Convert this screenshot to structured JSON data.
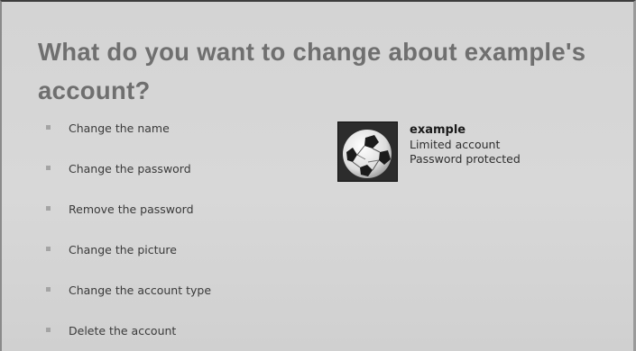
{
  "heading": "What do you want to change about example's account?",
  "tasks": [
    {
      "label": "Change the name"
    },
    {
      "label": "Change the password"
    },
    {
      "label": "Remove the password"
    },
    {
      "label": "Change the picture"
    },
    {
      "label": "Change the account type"
    },
    {
      "label": "Delete the account"
    }
  ],
  "account": {
    "name": "example",
    "type": "Limited account",
    "status": "Password protected",
    "picture_icon": "soccer-ball-icon"
  },
  "colors": {
    "heading": "#6f6f6f",
    "background": "#d4d4d4",
    "bullet": "#a4a4a4",
    "text": "#3a3a3a"
  }
}
